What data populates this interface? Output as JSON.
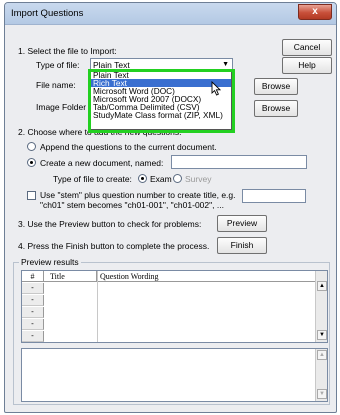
{
  "window": {
    "title": "Import Questions",
    "close_label": "x"
  },
  "buttons": {
    "cancel": "Cancel",
    "help": "Help",
    "browse_file": "Browse",
    "browse_folder": "Browse",
    "preview": "Preview",
    "finish": "Finish"
  },
  "step1": {
    "heading": "1.  Select the file to Import:",
    "type_label": "Type of file:",
    "type_value": "Plain Text",
    "file_name_label": "File name:",
    "image_folder_label": "Image Folder"
  },
  "dropdown": {
    "options": [
      "Plain Text",
      "Rich Text",
      "Microsoft Word (DOC)",
      "Microsoft Word 2007 (DOCX)",
      "Tab/Comma Delimited (CSV)",
      "StudyMate Class format (ZIP, XML)"
    ],
    "selected_index": 1
  },
  "step2": {
    "heading": "2.  Choose where to add the new questions:",
    "append_label": "Append the questions to the current document.",
    "create_label": "Create a new document, named:",
    "type_create_label": "Type of file to create:",
    "exam_label": "Exam",
    "survey_label": "Survey",
    "stem_line1": "Use \"stem\" plus question number to create title,  e.g.",
    "stem_line2": "\"ch01\" stem becomes \"ch01-001\",  \"ch01-002\", ..."
  },
  "step3": {
    "heading": "3.  Use the Preview button to check for problems:"
  },
  "step4": {
    "heading": "4.  Press the Finish button to complete the process."
  },
  "preview": {
    "group_label": "Preview results",
    "columns": [
      "#",
      "Title",
      "Question Wording"
    ],
    "rows": [
      "-",
      "-",
      "-",
      "-",
      "-"
    ]
  },
  "colors": {
    "highlight": "#23d021",
    "selection": "#3a6fd0",
    "close": "#c8503a"
  }
}
